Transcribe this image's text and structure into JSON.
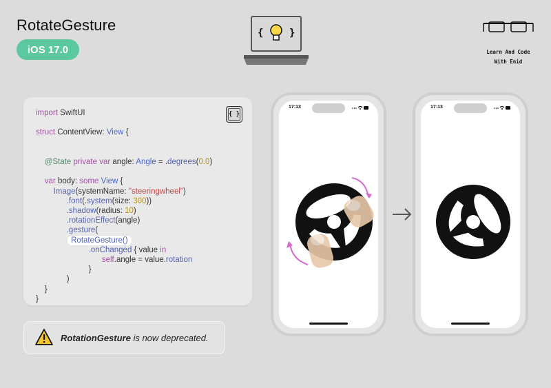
{
  "header": {
    "title": "RotateGesture",
    "badge": "iOS 17.0"
  },
  "brand": {
    "line1": "Learn And Code",
    "line2": "With Enid",
    "icon": "glasses-icon"
  },
  "laptop_icon": "laptop-lightbulb-icon",
  "code_button": {
    "label": "{ }"
  },
  "code": {
    "l1a": "import",
    "l1b": " SwiftUI",
    "l2a": "struct",
    "l2b": " ContentView: ",
    "l2c": "View",
    "l2d": " {",
    "l3a": "@State",
    "l3b": " private var",
    "l3c": " angle: ",
    "l3d": "Angle",
    "l3e": " = .",
    "l3f": "degrees",
    "l3g": "(",
    "l3h": "0.0",
    "l3i": ")",
    "l4a": "var",
    "l4b": " body: ",
    "l4c": "some",
    "l4d": " View",
    "l4e": " {",
    "l5a": "Image",
    "l5b": "(systemName: ",
    "l5c": "\"steeringwheel\"",
    "l5d": ")",
    "l6a": ".font",
    "l6b": "(.",
    "l6c": "system",
    "l6d": "(size: ",
    "l6e": "300",
    "l6f": "))",
    "l7a": ".shadow",
    "l7b": "(radius: ",
    "l7c": "10",
    "l7d": ")",
    "l8a": ".rotationEffect",
    "l8b": "(angle)",
    "l9a": ".gesture",
    "l9b": "(",
    "l10a": "RotateGesture",
    "l10b": "()",
    "l11a": ".onChanged",
    "l11b": " { value ",
    "l11c": "in",
    "l12a": "self",
    "l12b": ".angle = value.",
    "l12c": "rotation",
    "close1": "}",
    "close2": ")",
    "close3": "}",
    "close4": "}"
  },
  "note": {
    "bold": "RotationGesture",
    "rest": " is now deprecated.",
    "icon": "warning-icon"
  },
  "phones": [
    {
      "time": "17:13",
      "signal": "···",
      "wifi": "wifi-icon",
      "battery": "battery-icon"
    },
    {
      "time": "17:13",
      "signal": "···",
      "wifi": "wifi-icon",
      "battery": "battery-icon"
    }
  ],
  "colors": {
    "background": "#dcdcdc",
    "badge": "#5cc8a0",
    "rotation_arrows": "#d86ad0",
    "finger": "#e8c8a8",
    "wheel": "#111111"
  }
}
